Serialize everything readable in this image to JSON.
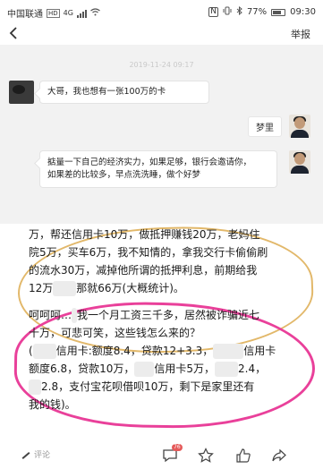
{
  "status_bar": {
    "carrier": "中国联通",
    "network_badge": "HD",
    "network_type": "4G",
    "battery": "77%",
    "battery_level": 0.77,
    "time": "09:30"
  },
  "nav": {
    "back_icon": "chevron-left-icon",
    "report_label": "举报"
  },
  "chat": {
    "timestamp": "2019-11-24 09:17",
    "message_1": "大哥，我也想有一张100万的卡",
    "sender_name": "梦里",
    "message_2_line1": "掂量一下自己的经济实力，如果足够，银行会邀请你，",
    "message_2_line2": "如果差的比较多，早点洗洗睡，做个好梦"
  },
  "article": {
    "line_1": "万，帮还信用卡10万，做抵押赚钱20万，老妈住",
    "line_2": "院5万，买车6万，我不知情的，拿我交行卡偷偷刷",
    "line_3": "的流水30万，减掉他所谓的抵押利息，前期给我",
    "line_4a": "12万",
    "line_4b": "那就66万(大概统计)。",
    "line_5a": "呵呵呵…",
    "line_5b": "我一个月工资三千多，居然被诈骗近七",
    "line_6": "十万，可悲可笑，这些钱怎么来的？",
    "line_7a": "(",
    "line_7b": "信用卡:额度8.4，贷款12+3.3，",
    "line_7c": "信用卡",
    "line_8a": "额度6.8，贷款10万，",
    "line_8b": "信用卡5万，",
    "line_8c": "2.4，",
    "line_9a": "2.8，支付宝花呗借呗10万，剩下是家里还有",
    "line_10": "我的钱)。"
  },
  "action_bar": {
    "comment_placeholder": "评论",
    "comment_count": "76",
    "icons": [
      "comment-icon",
      "star-icon",
      "like-icon",
      "share-icon"
    ]
  }
}
